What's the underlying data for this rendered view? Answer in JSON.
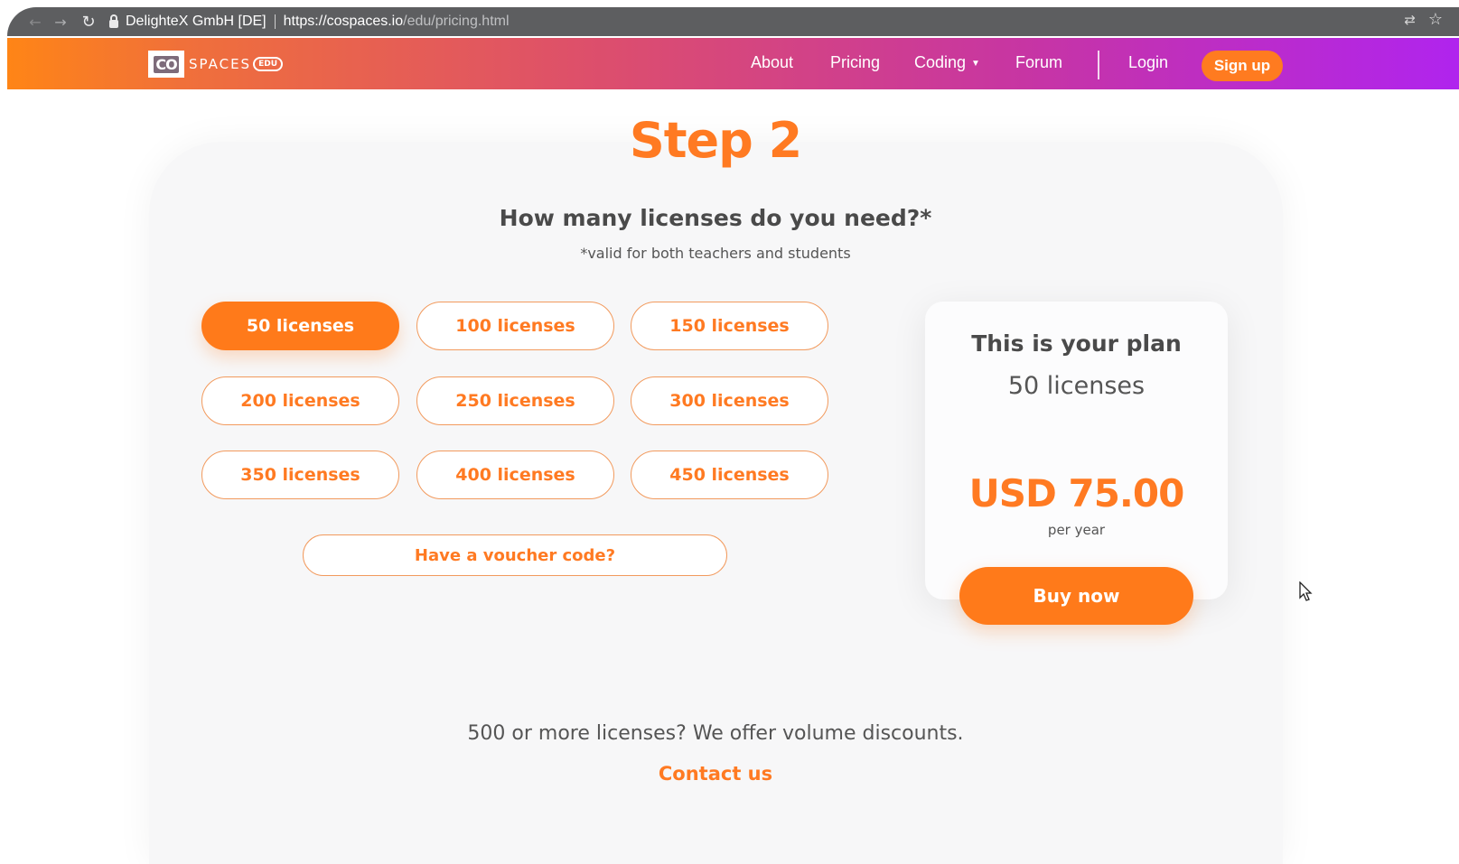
{
  "browser": {
    "site_identity": "DelighteX GmbH [DE]",
    "url_host": "https://cospaces.io",
    "url_path": "/edu/pricing.html",
    "icons": [
      "back-arrow-icon",
      "forward-arrow-icon",
      "reload-icon",
      "lock-icon",
      "translate-icon",
      "star-icon"
    ]
  },
  "nav": {
    "logo_co": "CO",
    "logo_spaces": "SPACES",
    "logo_edu": "EDU",
    "links": {
      "about": "About",
      "pricing": "Pricing",
      "coding": "Coding",
      "forum": "Forum",
      "login": "Login"
    },
    "signup": "Sign up"
  },
  "main": {
    "step_title": "Step 2",
    "question": "How many licenses do you need?*",
    "note": "*valid for both teachers and students",
    "license_options": [
      "50 licenses",
      "100 licenses",
      "150 licenses",
      "200 licenses",
      "250 licenses",
      "300 licenses",
      "350 licenses",
      "400 licenses",
      "450 licenses"
    ],
    "selected_option": "50 licenses",
    "voucher": "Have a voucher code?",
    "volume_text": "500 or more licenses? We offer volume discounts.",
    "contact": "Contact us"
  },
  "plan": {
    "title": "This is your plan",
    "licenses": "50 licenses",
    "price": "USD 75.00",
    "period": "per year",
    "buy": "Buy now"
  },
  "colors": {
    "accent": "#ff7a22",
    "nav_gradient_start": "#ff8516",
    "nav_gradient_end": "#b024ee"
  }
}
